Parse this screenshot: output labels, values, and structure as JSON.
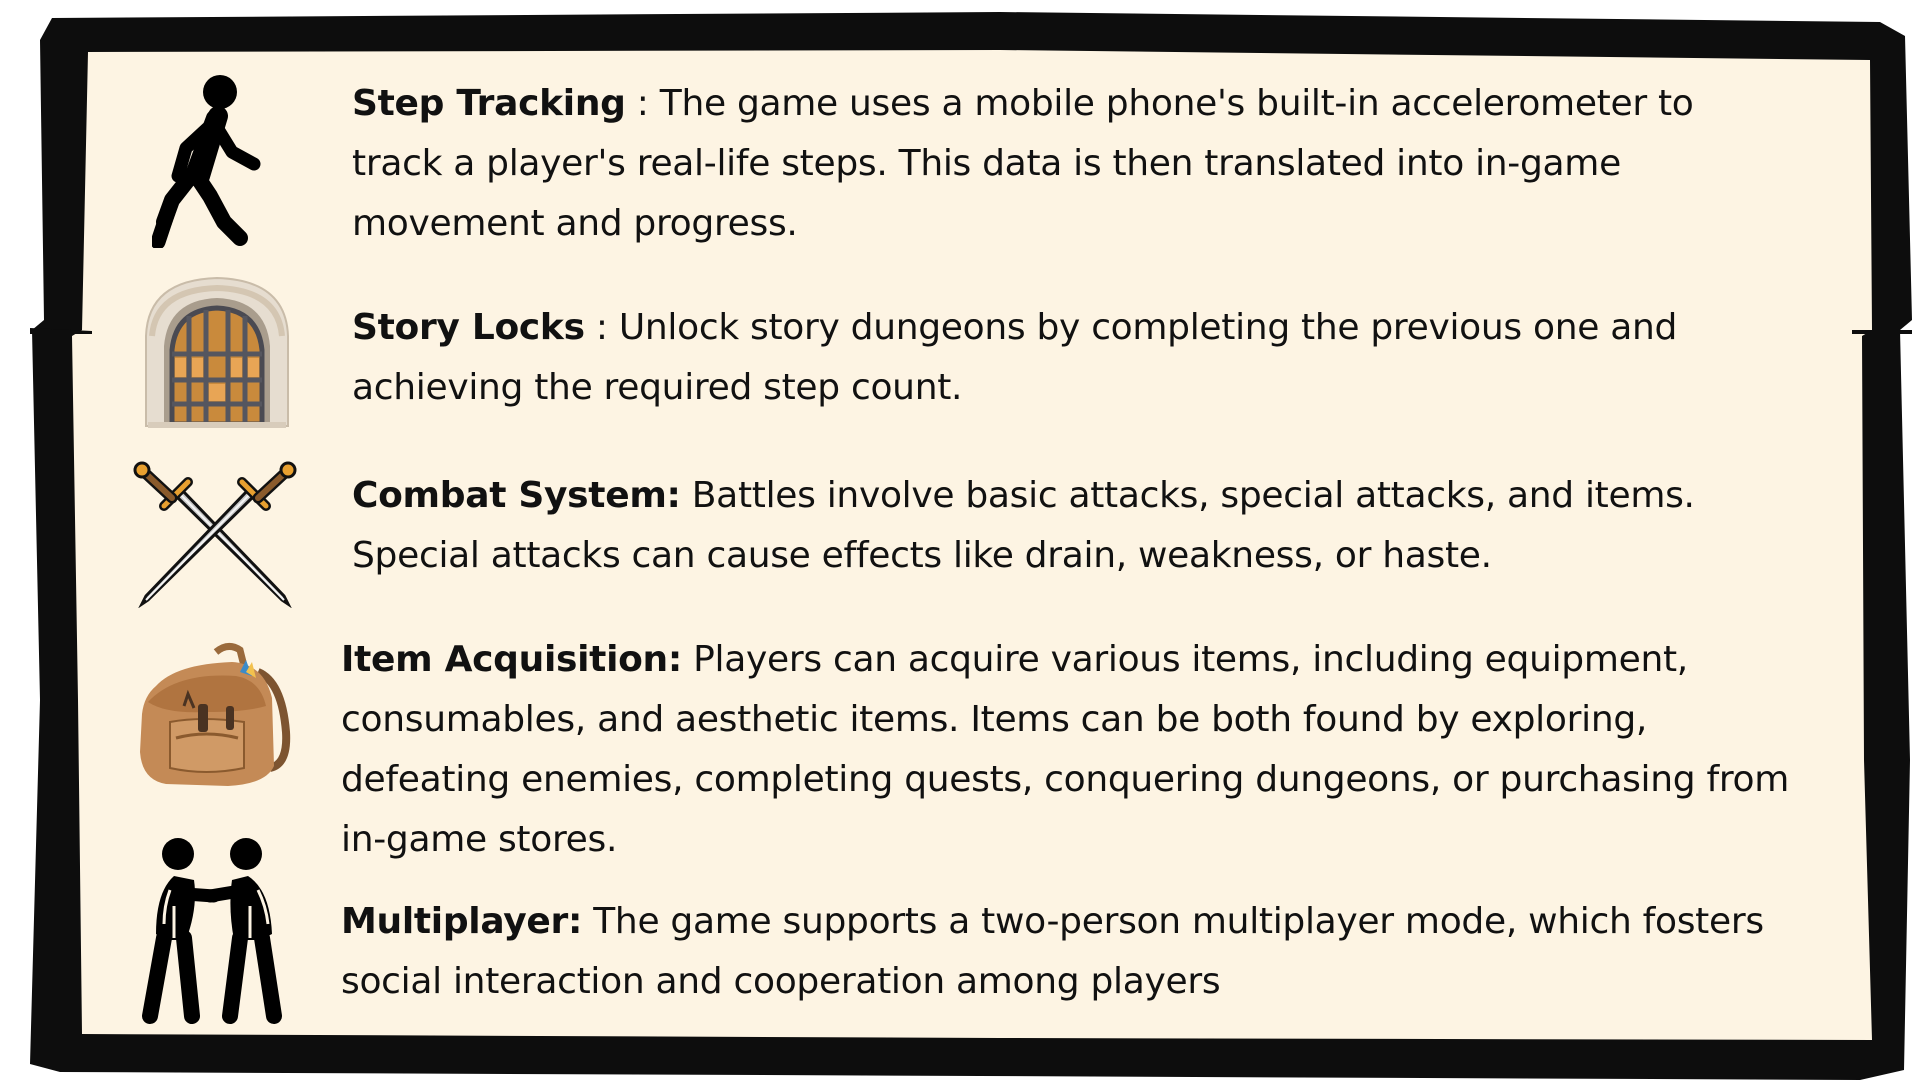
{
  "colors": {
    "parchment": "#fdf4e3",
    "frame": "#0d0d0d",
    "text": "#111111"
  },
  "features": [
    {
      "icon": "walking-person-icon",
      "title": "Step Tracking",
      "separator": " : ",
      "description": "The game uses a mobile phone's built-in accelerometer to track a player's real-life steps. This data is then translated into in-game movement and progress."
    },
    {
      "icon": "dungeon-door-icon",
      "title": "Story Locks",
      "separator": " : ",
      "description": "Unlock story dungeons by completing the previous one and achieving the required step count."
    },
    {
      "icon": "crossed-swords-icon",
      "title": "Combat System:",
      "separator": " ",
      "description": "Battles involve basic attacks, special attacks, and items. Special attacks can cause effects like drain, weakness, or haste."
    },
    {
      "icon": "backpack-icon",
      "title": "Item Acquisition:",
      "separator": " ",
      "description": "Players can acquire various items, including equipment, consumables, and aesthetic items. Items can be both found by exploring, defeating enemies, completing quests, conquering dungeons, or purchasing from in-game stores."
    },
    {
      "icon": "two-people-icon",
      "title": "Multiplayer:",
      "separator": " ",
      "description": "The game supports a two-person multiplayer mode, which fosters social interaction and cooperation among players"
    }
  ]
}
